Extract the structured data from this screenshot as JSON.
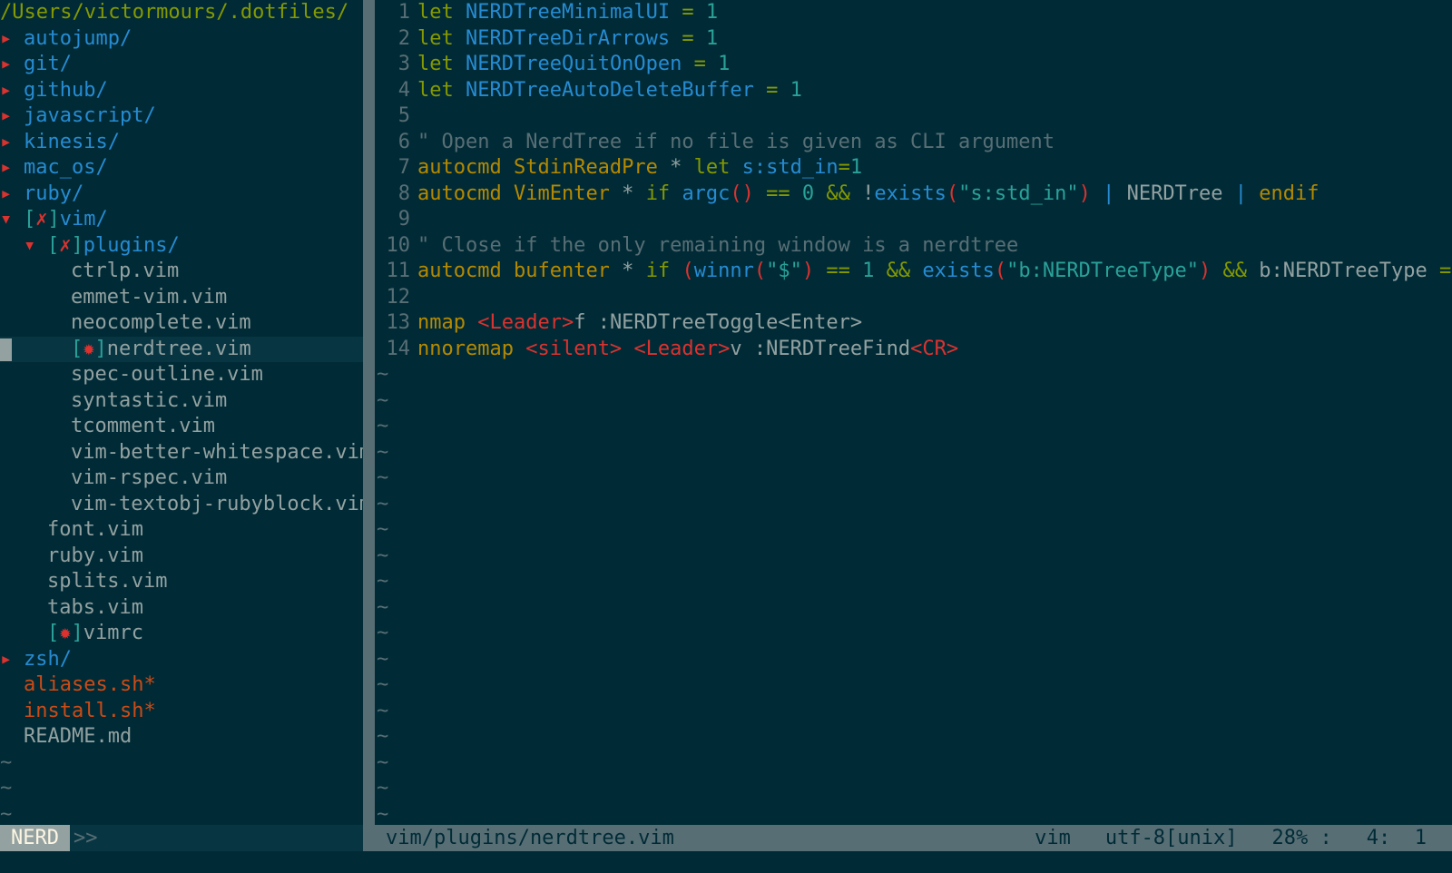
{
  "tree": {
    "root": "/Users/victormours/.dotfiles/",
    "items": [
      {
        "depth": 0,
        "arrow": "▸",
        "badge": "",
        "name": "autojump/",
        "kind": "dir"
      },
      {
        "depth": 0,
        "arrow": "▸",
        "badge": "",
        "name": "git/",
        "kind": "dir"
      },
      {
        "depth": 0,
        "arrow": "▸",
        "badge": "",
        "name": "github/",
        "kind": "dir"
      },
      {
        "depth": 0,
        "arrow": "▸",
        "badge": "",
        "name": "javascript/",
        "kind": "dir"
      },
      {
        "depth": 0,
        "arrow": "▸",
        "badge": "",
        "name": "kinesis/",
        "kind": "dir"
      },
      {
        "depth": 0,
        "arrow": "▸",
        "badge": "",
        "name": "mac_os/",
        "kind": "dir"
      },
      {
        "depth": 0,
        "arrow": "▸",
        "badge": "",
        "name": "ruby/",
        "kind": "dir"
      },
      {
        "depth": 0,
        "arrow": "▾",
        "badge": "✗",
        "name": "vim/",
        "kind": "dir"
      },
      {
        "depth": 1,
        "arrow": "▾",
        "badge": "✗",
        "name": "plugins/",
        "kind": "dir"
      },
      {
        "depth": 2,
        "arrow": "",
        "badge": "",
        "name": "ctrlp.vim",
        "kind": "file"
      },
      {
        "depth": 2,
        "arrow": "",
        "badge": "",
        "name": "emmet-vim.vim",
        "kind": "file"
      },
      {
        "depth": 2,
        "arrow": "",
        "badge": "",
        "name": "neocomplete.vim",
        "kind": "file"
      },
      {
        "depth": 2,
        "arrow": "",
        "badge": "✹",
        "name": "nerdtree.vim",
        "kind": "file",
        "selected": true
      },
      {
        "depth": 2,
        "arrow": "",
        "badge": "",
        "name": "spec-outline.vim",
        "kind": "file"
      },
      {
        "depth": 2,
        "arrow": "",
        "badge": "",
        "name": "syntastic.vim",
        "kind": "file"
      },
      {
        "depth": 2,
        "arrow": "",
        "badge": "",
        "name": "tcomment.vim",
        "kind": "file"
      },
      {
        "depth": 2,
        "arrow": "",
        "badge": "",
        "name": "vim-better-whitespace.vim",
        "kind": "file"
      },
      {
        "depth": 2,
        "arrow": "",
        "badge": "",
        "name": "vim-rspec.vim",
        "kind": "file"
      },
      {
        "depth": 2,
        "arrow": "",
        "badge": "",
        "name": "vim-textobj-rubyblock.vim",
        "kind": "file"
      },
      {
        "depth": 1,
        "arrow": "",
        "badge": "",
        "name": "font.vim",
        "kind": "file"
      },
      {
        "depth": 1,
        "arrow": "",
        "badge": "",
        "name": "ruby.vim",
        "kind": "file"
      },
      {
        "depth": 1,
        "arrow": "",
        "badge": "",
        "name": "splits.vim",
        "kind": "file"
      },
      {
        "depth": 1,
        "arrow": "",
        "badge": "",
        "name": "tabs.vim",
        "kind": "file"
      },
      {
        "depth": 1,
        "arrow": "",
        "badge": "✹",
        "name": "vimrc",
        "kind": "file"
      },
      {
        "depth": 0,
        "arrow": "▸",
        "badge": "",
        "name": "zsh/",
        "kind": "dir"
      },
      {
        "depth": 0,
        "arrow": "",
        "badge": "",
        "name": "aliases.sh*",
        "kind": "exec"
      },
      {
        "depth": 0,
        "arrow": "",
        "badge": "",
        "name": "install.sh*",
        "kind": "exec"
      },
      {
        "depth": 0,
        "arrow": "",
        "badge": "",
        "name": "README.md",
        "kind": "plain"
      }
    ],
    "trailing_tildes": 3
  },
  "editor": {
    "lines": [
      [
        [
          "let",
          "k-let"
        ],
        [
          " ",
          ""
        ],
        [
          "NERDTreeMinimalUI",
          "k-id"
        ],
        [
          " = ",
          "k-op"
        ],
        [
          "1",
          "k-num"
        ]
      ],
      [
        [
          "let",
          "k-let"
        ],
        [
          " ",
          ""
        ],
        [
          "NERDTreeDirArrows",
          "k-id"
        ],
        [
          " = ",
          "k-op"
        ],
        [
          "1",
          "k-num"
        ]
      ],
      [
        [
          "let",
          "k-let"
        ],
        [
          " ",
          ""
        ],
        [
          "NERDTreeQuitOnOpen",
          "k-id"
        ],
        [
          " = ",
          "k-op"
        ],
        [
          "1",
          "k-num"
        ]
      ],
      [
        [
          "let",
          "k-let"
        ],
        [
          " ",
          ""
        ],
        [
          "NERDTreeAutoDeleteBuffer",
          "k-id"
        ],
        [
          " = ",
          "k-op"
        ],
        [
          "1",
          "k-num"
        ]
      ],
      [],
      [
        [
          "\" Open a NerdTree if no file is given as CLI argument",
          "k-cmt"
        ]
      ],
      [
        [
          "autocmd",
          "k-ac"
        ],
        [
          " ",
          ""
        ],
        [
          "StdinReadPre",
          "k-ev"
        ],
        [
          " * ",
          "k-txt"
        ],
        [
          "let",
          "k-let"
        ],
        [
          " ",
          ""
        ],
        [
          "s:std_in",
          "k-id"
        ],
        [
          "=",
          "k-op"
        ],
        [
          "1",
          "k-num"
        ]
      ],
      [
        [
          "autocmd",
          "k-ac"
        ],
        [
          " ",
          ""
        ],
        [
          "VimEnter",
          "k-ev"
        ],
        [
          " * ",
          "k-txt"
        ],
        [
          "if",
          "k-let"
        ],
        [
          " ",
          ""
        ],
        [
          "argc",
          "k-fn"
        ],
        [
          "()",
          "k-par"
        ],
        [
          " == ",
          "k-op"
        ],
        [
          "0",
          "k-num"
        ],
        [
          " && ",
          "k-op"
        ],
        [
          "!",
          "k-txt"
        ],
        [
          "exists",
          "k-fn"
        ],
        [
          "(",
          "k-par"
        ],
        [
          "\"s:std_in\"",
          "k-str"
        ],
        [
          ")",
          "k-par"
        ],
        [
          " | ",
          "k-id"
        ],
        [
          "NERDTree",
          "k-txt"
        ],
        [
          " | ",
          "k-id"
        ],
        [
          "endif",
          "k-ac"
        ]
      ],
      [],
      [
        [
          "\" Close if the only remaining window is a nerdtree",
          "k-cmt"
        ]
      ],
      [
        [
          "autocmd",
          "k-ac"
        ],
        [
          " ",
          ""
        ],
        [
          "bufenter",
          "k-ev"
        ],
        [
          " * ",
          "k-txt"
        ],
        [
          "if",
          "k-let"
        ],
        [
          " ",
          ""
        ],
        [
          "(",
          "k-par"
        ],
        [
          "winnr",
          "k-fn"
        ],
        [
          "(",
          "k-par"
        ],
        [
          "\"$\"",
          "k-str"
        ],
        [
          ")",
          "k-par"
        ],
        [
          " == ",
          "k-op"
        ],
        [
          "1",
          "k-num"
        ],
        [
          " && ",
          "k-op"
        ],
        [
          "exists",
          "k-fn"
        ],
        [
          "(",
          "k-par"
        ],
        [
          "\"b:NERDTreeType\"",
          "k-str"
        ],
        [
          ")",
          "k-par"
        ],
        [
          " && ",
          "k-op"
        ],
        [
          "b:NERDTreeType",
          "k-txt"
        ],
        [
          " ==",
          "k-op"
        ]
      ],
      [],
      [
        [
          "nmap",
          "k-ac"
        ],
        [
          " ",
          ""
        ],
        [
          "<Leader>",
          "k-spec"
        ],
        [
          "f :NERDTreeToggle<Enter>",
          "k-txt"
        ]
      ],
      [
        [
          "nnoremap",
          "k-ac"
        ],
        [
          " ",
          ""
        ],
        [
          "<silent>",
          "k-spec"
        ],
        [
          " ",
          ""
        ],
        [
          "<Leader>",
          "k-spec"
        ],
        [
          "v :NERDTreeFind",
          "k-txt"
        ],
        [
          "<CR>",
          "k-spec"
        ]
      ]
    ],
    "tilde_rows": 18
  },
  "statusline": {
    "mode": "NERD",
    "mode_separator": ">>",
    "path": "vim/plugins/nerdtree.vim",
    "filetype": "vim",
    "encoding": "utf-8[unix]",
    "percent": "28% :",
    "position": "4:  1"
  }
}
